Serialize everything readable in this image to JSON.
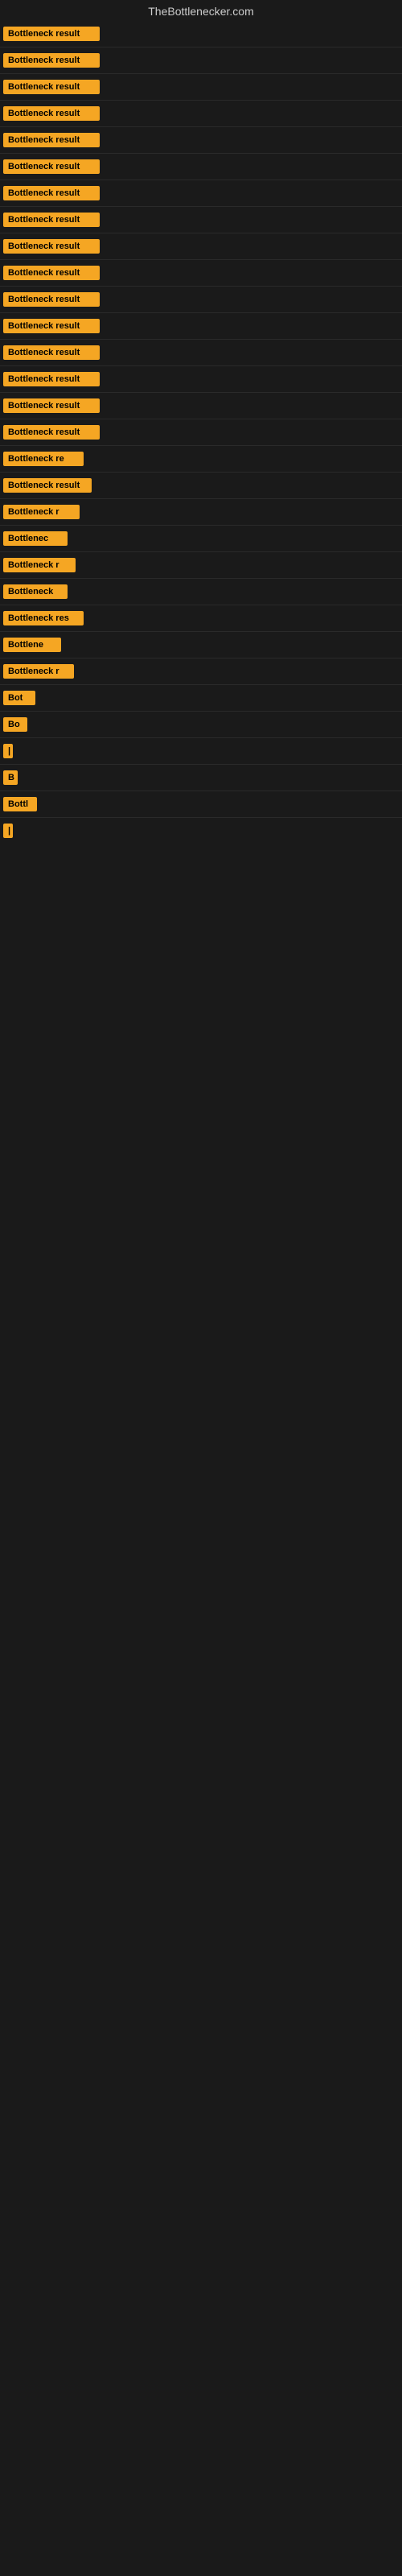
{
  "site": {
    "title": "TheBottlenecker.com"
  },
  "rows": [
    {
      "label": "Bottleneck result",
      "width": 120
    },
    {
      "label": "Bottleneck result",
      "width": 120
    },
    {
      "label": "Bottleneck result",
      "width": 120
    },
    {
      "label": "Bottleneck result",
      "width": 120
    },
    {
      "label": "Bottleneck result",
      "width": 120
    },
    {
      "label": "Bottleneck result",
      "width": 120
    },
    {
      "label": "Bottleneck result",
      "width": 120
    },
    {
      "label": "Bottleneck result",
      "width": 120
    },
    {
      "label": "Bottleneck result",
      "width": 120
    },
    {
      "label": "Bottleneck result",
      "width": 120
    },
    {
      "label": "Bottleneck result",
      "width": 120
    },
    {
      "label": "Bottleneck result",
      "width": 120
    },
    {
      "label": "Bottleneck result",
      "width": 120
    },
    {
      "label": "Bottleneck result",
      "width": 120
    },
    {
      "label": "Bottleneck result",
      "width": 120
    },
    {
      "label": "Bottleneck result",
      "width": 120
    },
    {
      "label": "Bottleneck re",
      "width": 100
    },
    {
      "label": "Bottleneck result",
      "width": 110
    },
    {
      "label": "Bottleneck r",
      "width": 95
    },
    {
      "label": "Bottlenec",
      "width": 80
    },
    {
      "label": "Bottleneck r",
      "width": 90
    },
    {
      "label": "Bottleneck",
      "width": 80
    },
    {
      "label": "Bottleneck res",
      "width": 100
    },
    {
      "label": "Bottlene",
      "width": 72
    },
    {
      "label": "Bottleneck r",
      "width": 88
    },
    {
      "label": "Bot",
      "width": 40
    },
    {
      "label": "Bo",
      "width": 30
    },
    {
      "label": "|",
      "width": 10
    },
    {
      "label": "B",
      "width": 18
    },
    {
      "label": "Bottl",
      "width": 42
    },
    {
      "label": "|",
      "width": 8
    }
  ]
}
